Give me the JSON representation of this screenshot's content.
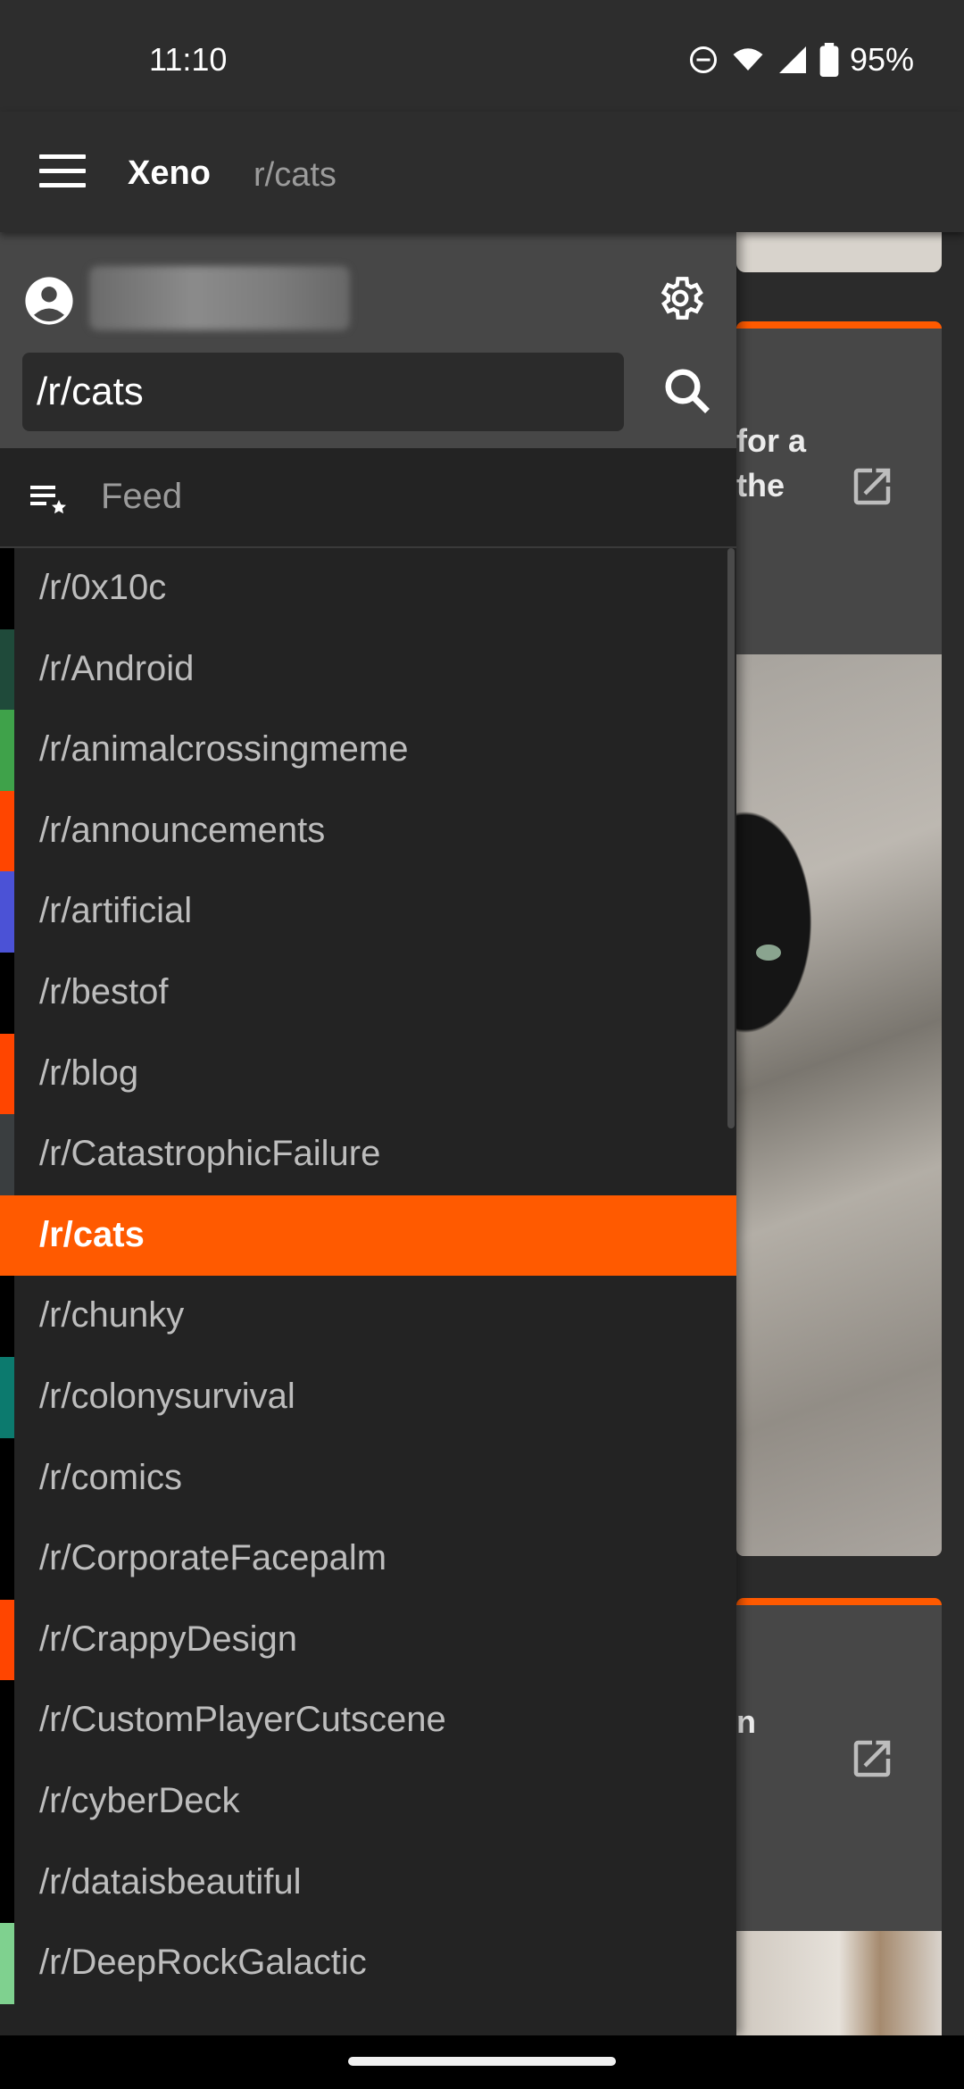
{
  "status_bar": {
    "time": "11:10",
    "battery": "95%",
    "icons": [
      "do-not-disturb-icon",
      "wifi-icon",
      "cell-signal-icon",
      "battery-icon"
    ]
  },
  "app_bar": {
    "title": "Xeno",
    "subtitle": "r/cats"
  },
  "drawer": {
    "search_value": "/r/cats",
    "feed_label": "Feed",
    "selected_subreddit": "/r/cats",
    "subreddits": [
      {
        "label": "/r/0x10c",
        "color": "#000000"
      },
      {
        "label": "/r/Android",
        "color": "#1f4a3a"
      },
      {
        "label": "/r/animalcrossingmeme",
        "color": "#3fa24a"
      },
      {
        "label": "/r/announcements",
        "color": "#ff4500"
      },
      {
        "label": "/r/artificial",
        "color": "#4b52d6"
      },
      {
        "label": "/r/bestof",
        "color": "#000000"
      },
      {
        "label": "/r/blog",
        "color": "#ff4500"
      },
      {
        "label": "/r/CatastrophicFailure",
        "color": "#3a3e40"
      },
      {
        "label": "/r/cats",
        "color": "#ff5a00"
      },
      {
        "label": "/r/chunky",
        "color": "#000000"
      },
      {
        "label": "/r/colonysurvival",
        "color": "#0c7a6e"
      },
      {
        "label": "/r/comics",
        "color": "#000000"
      },
      {
        "label": "/r/CorporateFacepalm",
        "color": "#000000"
      },
      {
        "label": "/r/CrappyDesign",
        "color": "#ff4500"
      },
      {
        "label": "/r/CustomPlayerCutscene",
        "color": "#000000"
      },
      {
        "label": "/r/cyberDeck",
        "color": "#000000"
      },
      {
        "label": "/r/dataisbeautiful",
        "color": "#000000"
      },
      {
        "label": "/r/DeepRockGalactic",
        "color": "#7fd18f"
      }
    ]
  },
  "background_cards": [
    {
      "text_lines": [
        "for a",
        "the"
      ]
    },
    {
      "text_lines": [
        "n"
      ]
    }
  ],
  "colors": {
    "accent": "#ff5a00",
    "drawer_bg": "#232323",
    "header_bg": "#474747"
  }
}
